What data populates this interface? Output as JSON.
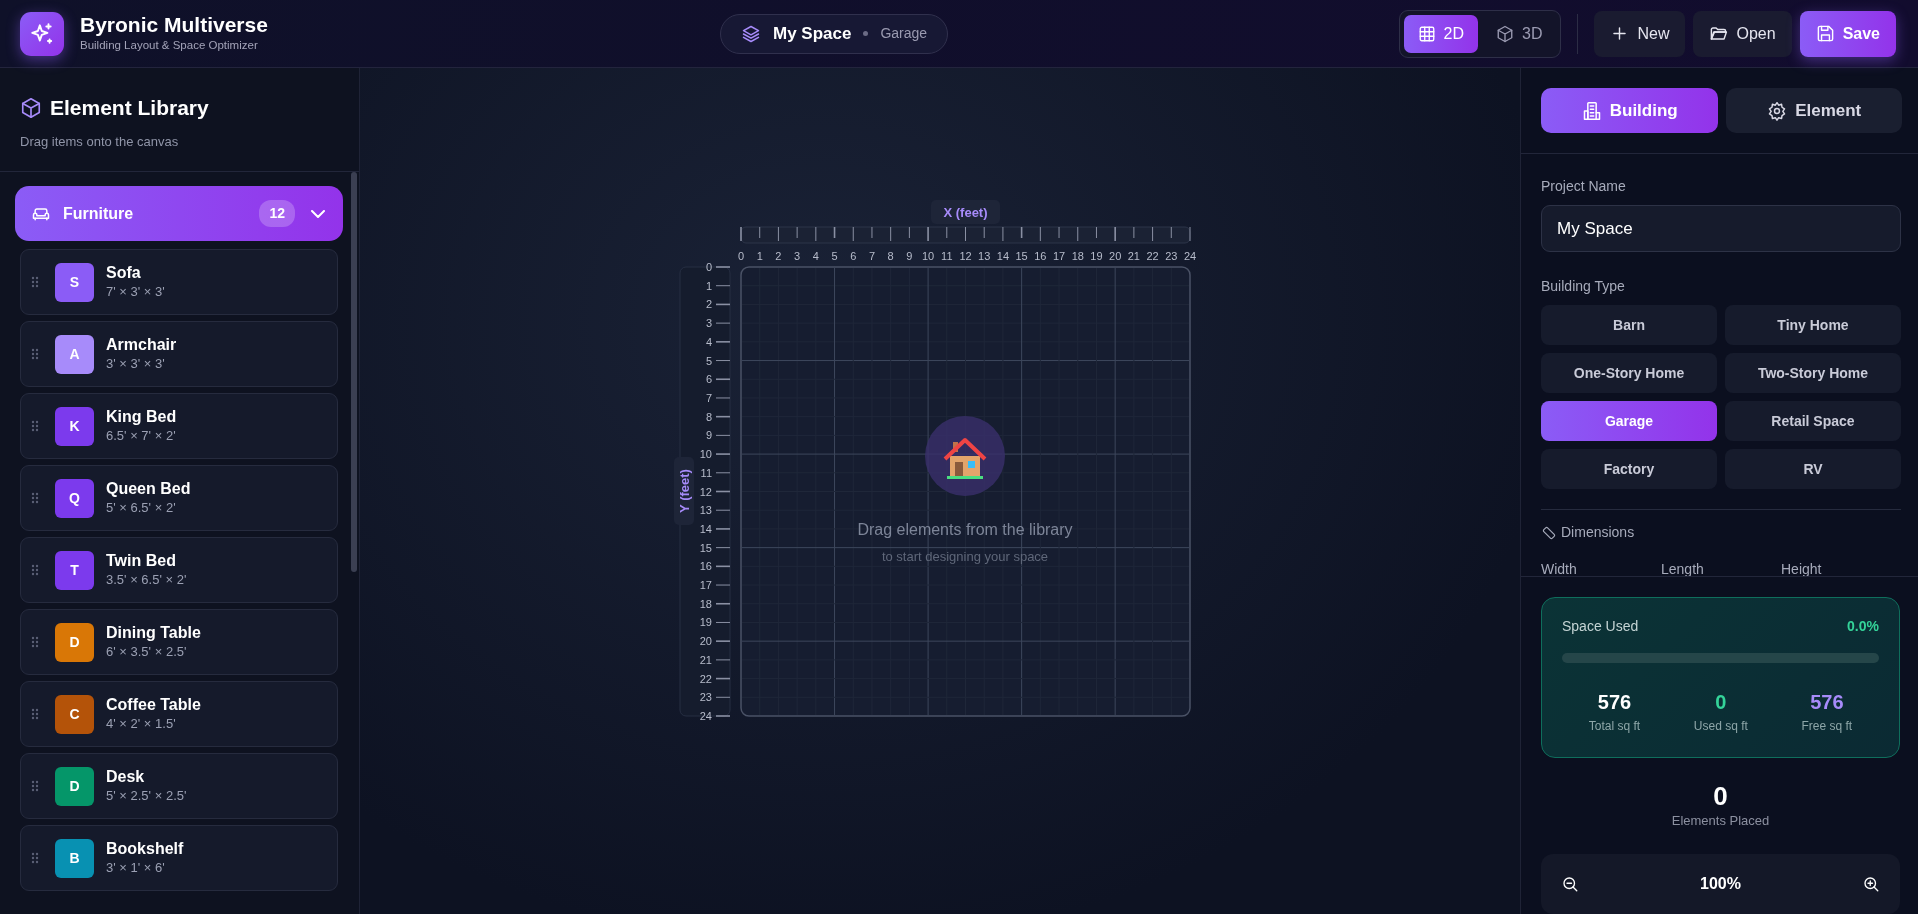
{
  "app": {
    "title": "Byronic Multiverse",
    "subtitle": "Building Layout & Space Optimizer"
  },
  "breadcrumb": {
    "project": "My Space",
    "type": "Garage"
  },
  "view_toggle": [
    {
      "label": "2D",
      "kind": "grid",
      "selected": true
    },
    {
      "label": "3D",
      "kind": "cube",
      "selected": false
    }
  ],
  "actions": [
    {
      "label": "New",
      "kind": "plus"
    },
    {
      "label": "Open",
      "kind": "folder"
    },
    {
      "label": "Save",
      "kind": "save"
    }
  ],
  "library": {
    "title": "Element Library",
    "subtitle": "Drag items onto the canvas",
    "category": {
      "label": "Furniture",
      "count": "12",
      "expanded": true
    },
    "items": [
      {
        "letter": "S",
        "name": "Sofa",
        "dims": "7' × 3' × 3'",
        "color": "#8b5cf6"
      },
      {
        "letter": "A",
        "name": "Armchair",
        "dims": "3' × 3' × 3'",
        "color": "#a78bfa"
      },
      {
        "letter": "K",
        "name": "King Bed",
        "dims": "6.5' × 7' × 2'",
        "color": "#7c3aed"
      },
      {
        "letter": "Q",
        "name": "Queen Bed",
        "dims": "5' × 6.5' × 2'",
        "color": "#7c3aed"
      },
      {
        "letter": "T",
        "name": "Twin Bed",
        "dims": "3.5' × 6.5' × 2'",
        "color": "#7c3aed"
      },
      {
        "letter": "D",
        "name": "Dining Table",
        "dims": "6' × 3.5' × 2.5'",
        "color": "#d97706"
      },
      {
        "letter": "C",
        "name": "Coffee Table",
        "dims": "4' × 2' × 1.5'",
        "color": "#b45309"
      },
      {
        "letter": "D",
        "name": "Desk",
        "dims": "5' × 2.5' × 2.5'",
        "color": "#059669"
      },
      {
        "letter": "B",
        "name": "Bookshelf",
        "dims": "3' × 1' × 6'",
        "color": "#0891b2"
      }
    ]
  },
  "canvas": {
    "x_axis": "X (feet)",
    "y_axis": "Y (feet)",
    "x_labels": [
      "0",
      "1",
      "2",
      "3",
      "4",
      "5",
      "6",
      "7",
      "8",
      "9",
      "10",
      "11",
      "12",
      "13",
      "14",
      "15",
      "16",
      "17",
      "18",
      "19",
      "20",
      "21",
      "22",
      "23",
      "24"
    ],
    "y_labels": [
      "0",
      "1",
      "2",
      "3",
      "4",
      "5",
      "6",
      "7",
      "8",
      "9",
      "10",
      "11",
      "12",
      "13",
      "14",
      "15",
      "16",
      "17",
      "18",
      "19",
      "20",
      "21",
      "22",
      "23",
      "24"
    ],
    "empty_title": "Drag elements from the library",
    "empty_subtitle": "to start designing your space"
  },
  "panel": {
    "tabs": [
      {
        "label": "Building",
        "kind": "building",
        "selected": true
      },
      {
        "label": "Element",
        "kind": "gear",
        "selected": false
      }
    ],
    "project_label": "Project Name",
    "project_value": "My Space",
    "type_label": "Building Type",
    "types": [
      {
        "label": "Barn",
        "selected": false
      },
      {
        "label": "Tiny Home",
        "selected": false
      },
      {
        "label": "One-Story Home",
        "selected": false
      },
      {
        "label": "Two-Story Home",
        "selected": false
      },
      {
        "label": "Garage",
        "selected": true
      },
      {
        "label": "Retail Space",
        "selected": false
      },
      {
        "label": "Factory",
        "selected": false
      },
      {
        "label": "RV",
        "selected": false
      }
    ],
    "dimensions_label": "Dimensions",
    "dimension_fields": [
      "Width",
      "Length",
      "Height"
    ],
    "space": {
      "label": "Space Used",
      "percent": "0.0%",
      "level": 0,
      "stats": [
        {
          "value": "576",
          "label": "Total sq ft",
          "kind": "total"
        },
        {
          "value": "0",
          "label": "Used sq ft",
          "kind": "used"
        },
        {
          "value": "576",
          "label": "Free sq ft",
          "kind": "free"
        }
      ]
    },
    "elements_count": "0",
    "elements_label": "Elements Placed",
    "zoom": "100%"
  }
}
